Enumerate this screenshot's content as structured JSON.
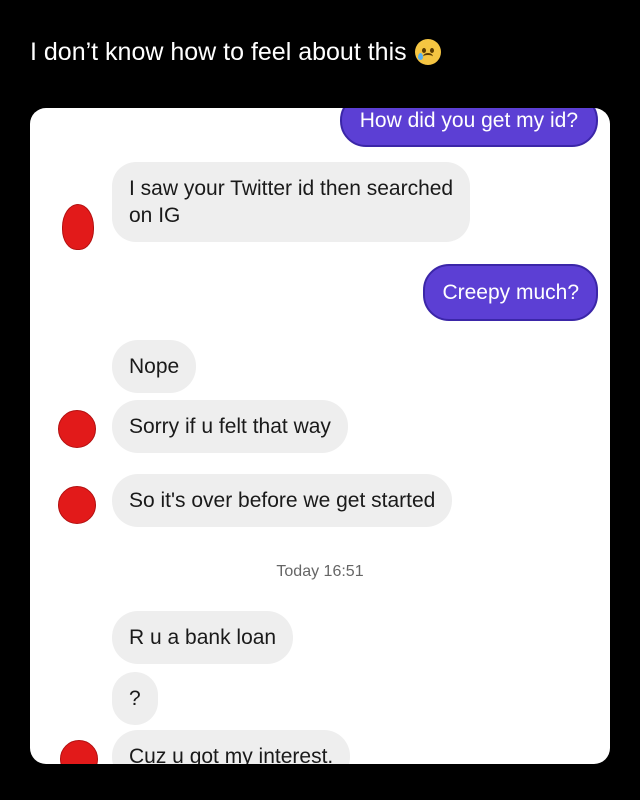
{
  "post": {
    "caption": "I don’t know how to feel about this",
    "emoji_icon": "face-holding-back-tears-icon"
  },
  "conversation": {
    "messages": [
      {
        "side": "sent",
        "text": "How did you get my id?"
      },
      {
        "side": "received",
        "text_line1": "I saw your Twitter id then searched",
        "text_line2": "on IG"
      },
      {
        "side": "sent",
        "text": "Creepy much?"
      },
      {
        "side": "received",
        "text": "Nope"
      },
      {
        "side": "received",
        "text": "Sorry if u felt that way"
      },
      {
        "side": "received",
        "text": "So it's over before we get started"
      },
      {
        "side": "received",
        "text": "R u a bank loan"
      },
      {
        "side": "received",
        "text": "?"
      },
      {
        "side": "received",
        "text": "Cuz u got my interest."
      }
    ],
    "timestamp": "Today 16:51",
    "colors": {
      "sent_bubble": "#5c3fd4",
      "received_bubble": "#eeeeee",
      "avatar": "#e21a1a"
    }
  }
}
